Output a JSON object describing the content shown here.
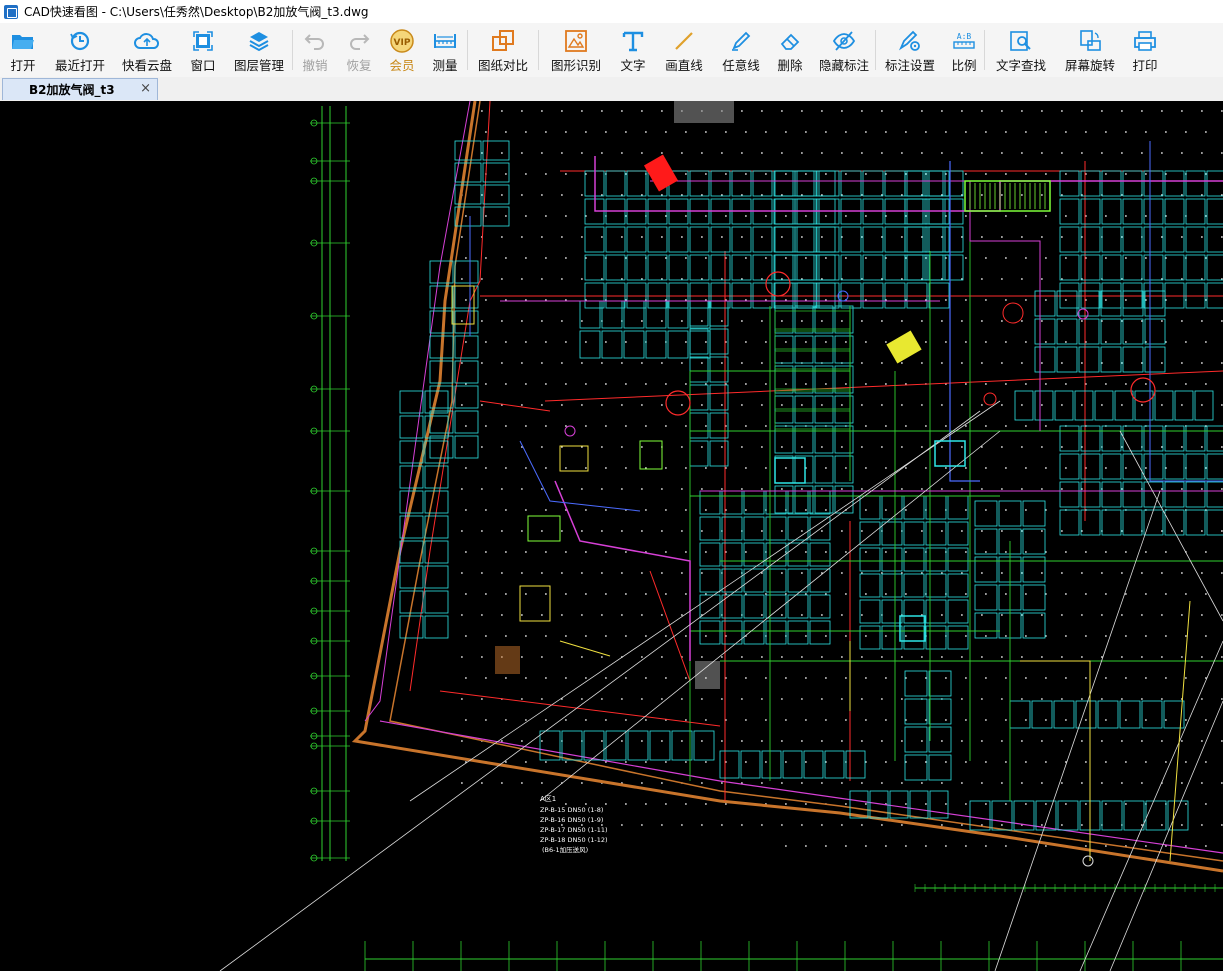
{
  "window": {
    "title": "CAD快速看图 - C:\\Users\\任秀然\\Desktop\\B2加放气阀_t3.dwg"
  },
  "toolbar": {
    "items": [
      {
        "label": "打开",
        "icon": "folder-open-icon",
        "enabled": true
      },
      {
        "label": "最近打开",
        "icon": "history-icon",
        "enabled": true
      },
      {
        "label": "快看云盘",
        "icon": "cloud-icon",
        "enabled": true
      },
      {
        "label": "窗口",
        "icon": "window-icon",
        "enabled": true
      },
      {
        "label": "图层管理",
        "icon": "layers-icon",
        "enabled": true
      },
      {
        "label": "撤销",
        "icon": "undo-icon",
        "enabled": false
      },
      {
        "label": "恢复",
        "icon": "redo-icon",
        "enabled": false
      },
      {
        "label": "会员",
        "icon": "vip-icon",
        "enabled": true
      },
      {
        "label": "测量",
        "icon": "ruler-icon",
        "enabled": true
      },
      {
        "label": "图纸对比",
        "icon": "compare-icon",
        "enabled": true
      },
      {
        "label": "图形识别",
        "icon": "shape-recognize-icon",
        "enabled": true
      },
      {
        "label": "文字",
        "icon": "text-icon",
        "enabled": true
      },
      {
        "label": "画直线",
        "icon": "line-icon",
        "enabled": true
      },
      {
        "label": "任意线",
        "icon": "pen-icon",
        "enabled": true
      },
      {
        "label": "删除",
        "icon": "eraser-icon",
        "enabled": true
      },
      {
        "label": "隐藏标注",
        "icon": "eye-hide-icon",
        "enabled": true
      },
      {
        "label": "标注设置",
        "icon": "annotation-settings-icon",
        "enabled": true
      },
      {
        "label": "比例",
        "icon": "scale-icon",
        "enabled": true
      },
      {
        "label": "文字查找",
        "icon": "text-search-icon",
        "enabled": true
      },
      {
        "label": "屏幕旋转",
        "icon": "rotate-screen-icon",
        "enabled": true
      },
      {
        "label": "打印",
        "icon": "printer-icon",
        "enabled": true
      }
    ],
    "vip_badge": "VIP"
  },
  "tabs": [
    {
      "label": "B2加放气阀_t3",
      "close_glyph": "×",
      "active": true
    }
  ],
  "colors": {
    "accent": "#1e8fe1",
    "vip": "#c98a1b",
    "canvas_bg": "#000000"
  },
  "drawing": {
    "annotations": [
      "A区1",
      "ZP-B-15 DN50  (1-8)",
      "ZP-B-16 DN50  (1-9)",
      "ZP-B-17 DN50  (1-11)",
      "ZP-B-18 DN50  (1-12)",
      "(B6-1加压送风)"
    ]
  }
}
